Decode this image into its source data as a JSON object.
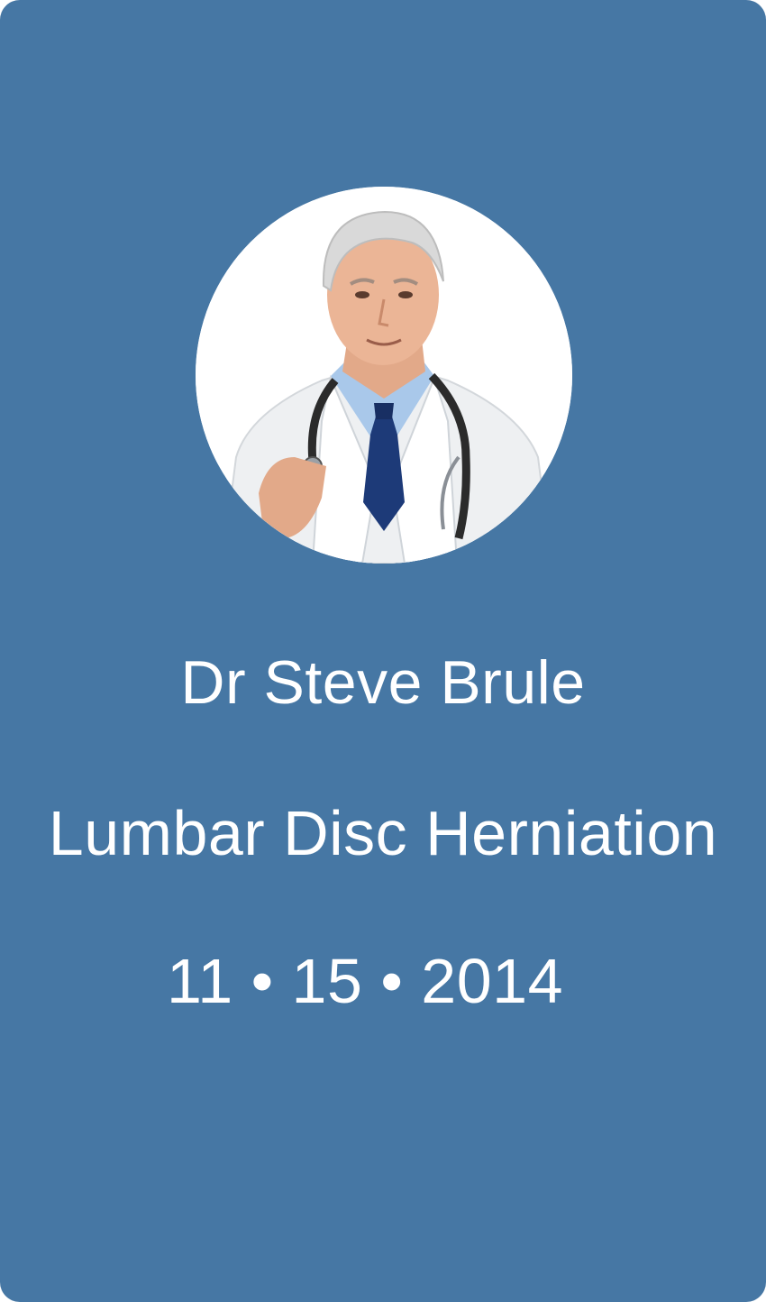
{
  "profile": {
    "photo_icon": "doctor-portrait",
    "name": "Dr Steve Brule",
    "condition": "Lumbar Disc Herniation",
    "date": "11 • 15 • 2014"
  },
  "colors": {
    "card_background": "#4677a4",
    "text": "#ffffff"
  }
}
